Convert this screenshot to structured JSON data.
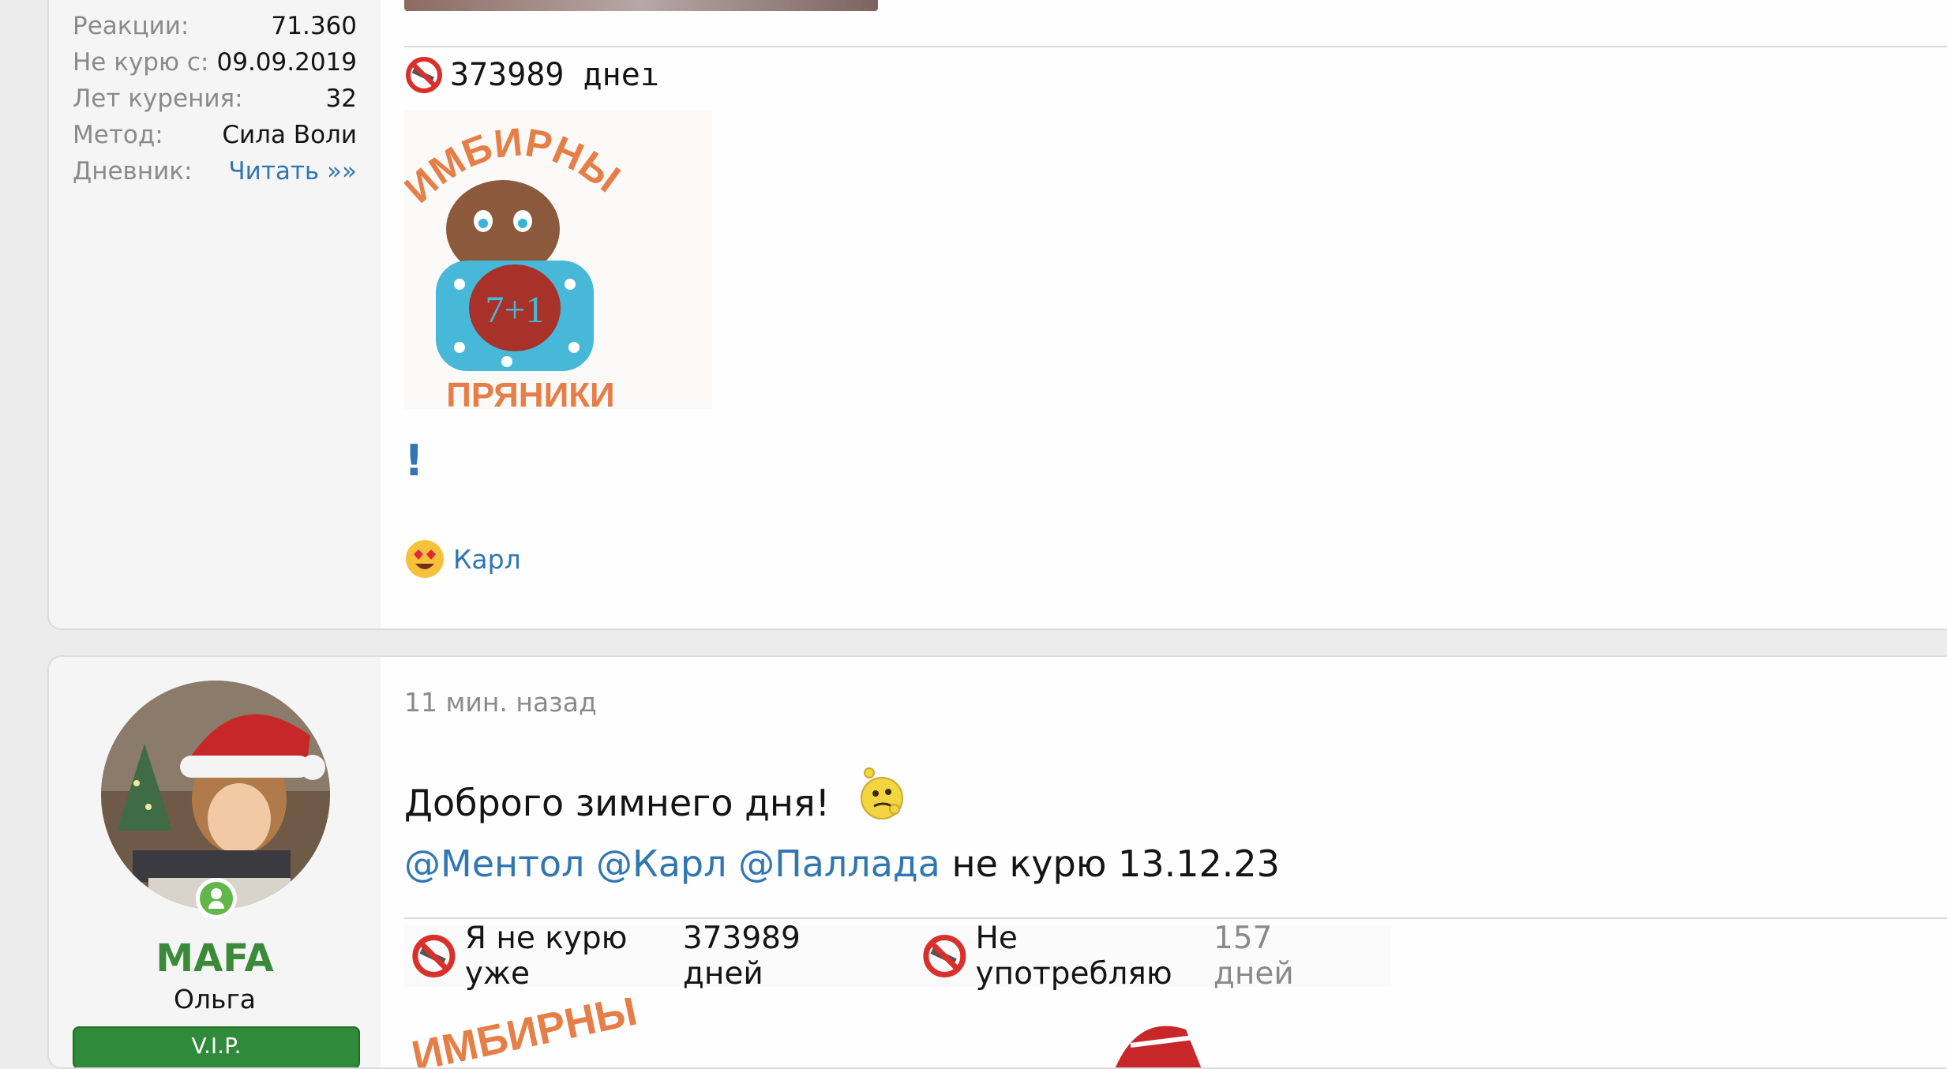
{
  "colors": {
    "page_background": "#ececec",
    "link": "#2f76b2",
    "username_green": "#3a8a3a",
    "muted_label": "#8a8a8a",
    "vip_badge": "#2f8a3a"
  },
  "post1": {
    "stats": [
      {
        "label": "Реакции:",
        "value": "71.360",
        "is_link": false
      },
      {
        "label": "Не курю с:",
        "value": "09.09.2019",
        "is_link": false
      },
      {
        "label": "Лет курения:",
        "value": "32",
        "is_link": false
      },
      {
        "label": "Метод:",
        "value": "Сила Воли",
        "is_link": false
      },
      {
        "label": "Дневник:",
        "value": "Читать »»",
        "is_link": true
      }
    ],
    "signature_counter": "373989 днеı",
    "signature_icon": "no-smoking-icon",
    "ginger_banner": {
      "top_text": "ИМБИРНЫЕ",
      "bottom_text": "ПРЯНИКИ",
      "samovar_text": "7+1"
    },
    "exclamation": "!",
    "reaction": {
      "icon": "heart-eyes-emoji-icon",
      "user": "Карл"
    }
  },
  "post2": {
    "user": {
      "name": "MAFA",
      "title": "Ольга",
      "badge": "V.I.P.",
      "online_icon": "online-user-icon"
    },
    "time": "11 мин. назад",
    "greeting": "Доброго зимнего дня!",
    "greeting_emoji": "thinking-emoji-icon",
    "mentions": [
      "@Ментол",
      "@Карл",
      "@Паллада"
    ],
    "message_tail": "не курю 13.12.23",
    "signature": [
      {
        "label": "Я не курю уже",
        "value": "373989 дней",
        "icon": "no-smoking-icon"
      },
      {
        "label": "Не употребляю",
        "value": "157 дней",
        "icon": "no-smoking-icon"
      }
    ],
    "bottom_banner_text": "ИМБИРНЫ"
  }
}
